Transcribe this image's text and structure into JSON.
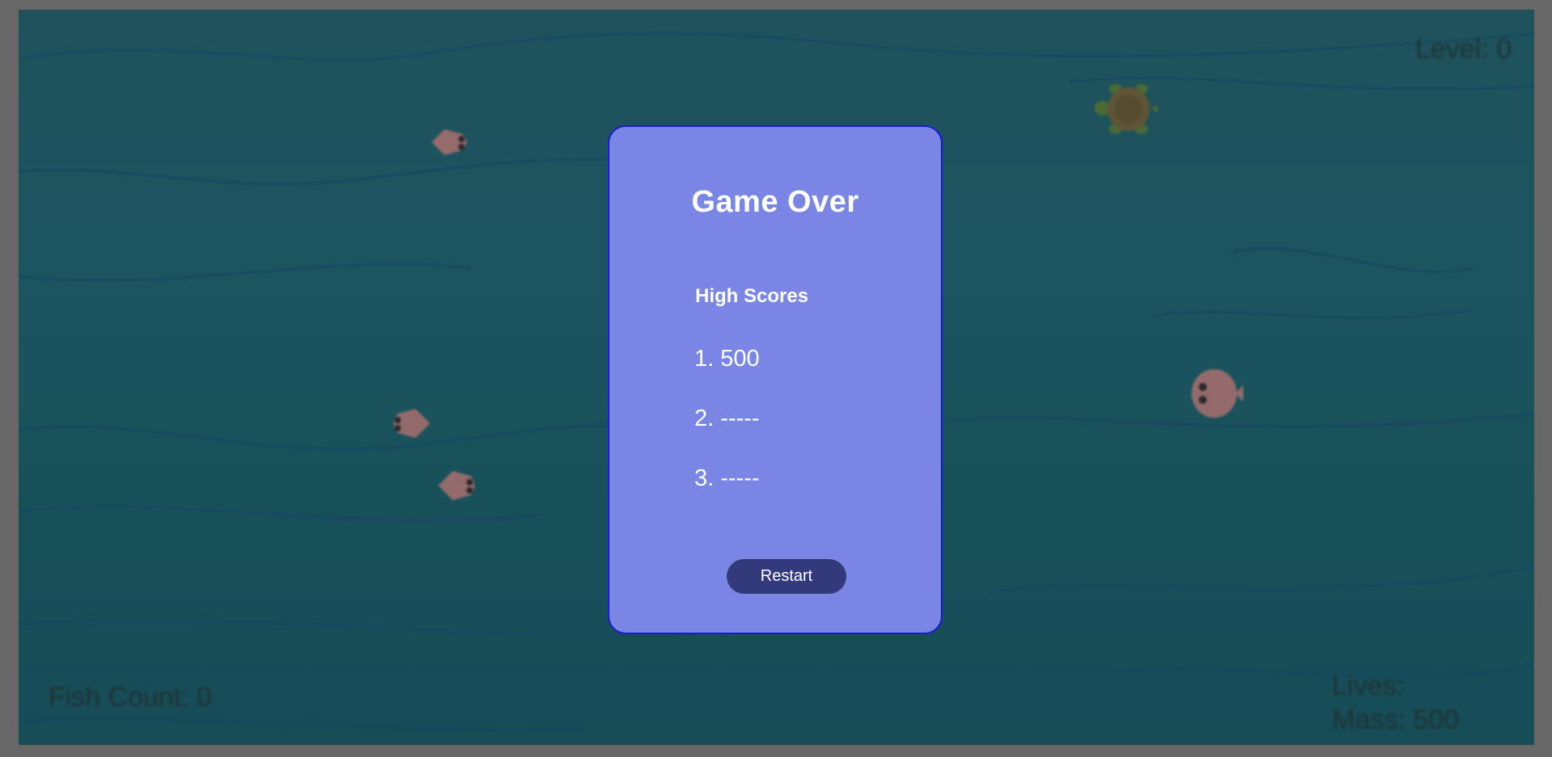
{
  "hud": {
    "level": "Level: 0",
    "fish_count": "Fish Count: 0",
    "lives": "Lives:",
    "mass": "Mass: 500"
  },
  "modal": {
    "title": "Game Over",
    "scores_heading": "High Scores",
    "scores": [
      "1. 500",
      "2. -----",
      "3. -----"
    ],
    "restart_label": "Restart"
  },
  "colors": {
    "ocean": "#175a66",
    "modal_bg": "#7986e4",
    "modal_border": "#1a1ad8",
    "button_bg": "#333a7c",
    "fish": "#c97b7a",
    "turtle": "#7a5a2a"
  },
  "sprites": [
    "fish-icon",
    "fish-icon",
    "fish-icon",
    "pufferfish-icon",
    "turtle-icon"
  ]
}
